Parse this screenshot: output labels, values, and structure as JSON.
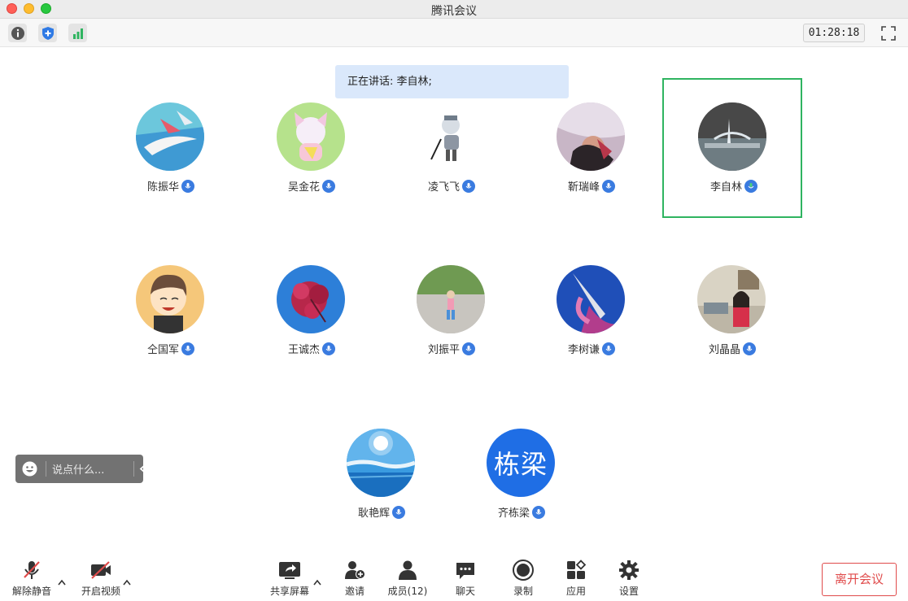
{
  "window": {
    "title": "腾讯会议"
  },
  "toolbar": {
    "icons": [
      "info-icon",
      "shield-icon",
      "signal-icon",
      "fullscreen-icon"
    ],
    "timer": "01:28:18"
  },
  "speaking_banner": "正在讲话: 李自林;",
  "participants": [
    {
      "name": "陈振华"
    },
    {
      "name": "吴金花"
    },
    {
      "name": "凌飞飞"
    },
    {
      "name": "靳瑞峰"
    },
    {
      "name": "李自林",
      "active": true
    },
    {
      "name": "仝国军"
    },
    {
      "name": "王诚杰"
    },
    {
      "name": "刘振平"
    },
    {
      "name": "李树谦"
    },
    {
      "name": "刘晶晶"
    },
    {
      "name": "耿艳辉"
    },
    {
      "name": "齐栋梁",
      "avatar_text": "栋梁"
    }
  ],
  "chat": {
    "placeholder": "说点什么..."
  },
  "controls": {
    "unmute": "解除静音",
    "video": "开启视频",
    "share": "共享屏幕",
    "invite": "邀请",
    "members": "成员(12)",
    "chat": "聊天",
    "record": "录制",
    "apps": "应用",
    "settings": "设置",
    "leave": "离开会议"
  },
  "colors": {
    "accent": "#1f6ee5",
    "active_border": "#2fb460",
    "leave": "#e04b4b",
    "banner": "#dae8fb"
  }
}
